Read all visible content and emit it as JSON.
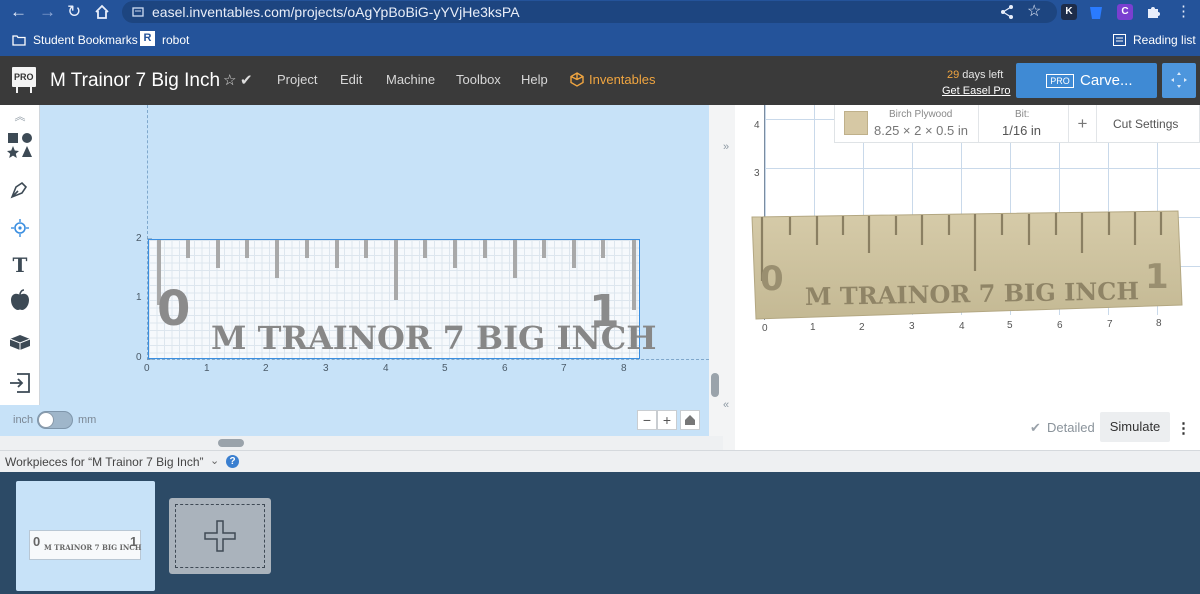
{
  "browser": {
    "url": "easel.inventables.com/projects/oAgYpBoBiG-yYVjHe3ksPA",
    "bookmarks": [
      "Student Bookmarks",
      "robot"
    ],
    "reading_list": "Reading list",
    "ext_k": "K",
    "ext_c": "C"
  },
  "header": {
    "logo_text": "PRO",
    "project_title": "M Trainor 7 Big Inch",
    "menu": [
      "Project",
      "Edit",
      "Machine",
      "Toolbox",
      "Help",
      "Inventables"
    ],
    "trial_days": "29",
    "trial_suffix": " days left",
    "get_pro": "Get Easel Pro",
    "carve_pro_tag": "PRO",
    "carve_label": "Carve..."
  },
  "design": {
    "text_line": "M TRAINOR 7 BIG INCH",
    "digit_zero": "0",
    "digit_one": "1",
    "x_ticks": [
      "0",
      "1",
      "2",
      "3",
      "4",
      "5",
      "6",
      "7",
      "8"
    ],
    "y_ticks": [
      "0",
      "1",
      "2"
    ],
    "unit_inch": "inch",
    "unit_mm": "mm",
    "zoom_out": "−",
    "zoom_in": "+"
  },
  "preview": {
    "material_name": "Birch Plywood",
    "material_dims": "8.25 × 2 × 0.5 in",
    "bit_label": "Bit:",
    "bit_value": "1/16 in",
    "add_label": "+",
    "cut_settings": "Cut Settings",
    "x_ticks": [
      "0",
      "1",
      "2",
      "3",
      "4",
      "5",
      "6",
      "7",
      "8"
    ],
    "y_ticks": [
      "3",
      "4"
    ],
    "detailed": "Detailed",
    "simulate": "Simulate",
    "more": "⋮"
  },
  "workpieces": {
    "label": "Workpieces for “M Trainor 7 Big Inch”",
    "thumb_text": "M TRAINOR 7 BIG INCH",
    "thumb_zero": "0",
    "thumb_one": "1"
  },
  "colors": {
    "browser": "#24539a",
    "header": "#3a3a3a",
    "accent_orange": "#f0a540",
    "carve_blue": "#3f8ad4",
    "design_bg": "#c7e2f8",
    "tray": "#2c4a66",
    "wood": "#cdc2a4"
  }
}
